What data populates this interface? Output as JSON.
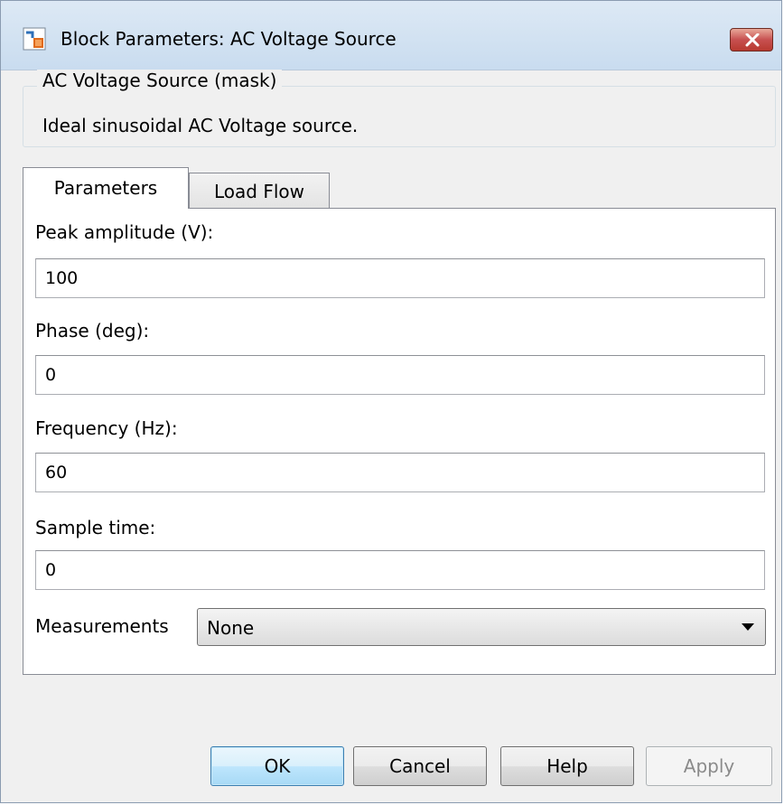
{
  "window": {
    "title": "Block Parameters: AC Voltage Source",
    "close_icon": "close-x-icon",
    "app_icon": "simulink-block-icon"
  },
  "mask": {
    "title": "AC Voltage Source (mask)",
    "description": "Ideal sinusoidal AC Voltage source."
  },
  "tabs": [
    {
      "label": "Parameters",
      "active": true
    },
    {
      "label": "Load Flow",
      "active": false
    }
  ],
  "fields": {
    "peak_amplitude": {
      "label": "Peak amplitude (V):",
      "value": "100"
    },
    "phase": {
      "label": "Phase (deg):",
      "value": "0"
    },
    "frequency": {
      "label": "Frequency (Hz):",
      "value": "60"
    },
    "sample_time": {
      "label": "Sample time:",
      "value": "0"
    }
  },
  "measurements": {
    "label": "Measurements",
    "selected": "None"
  },
  "buttons": {
    "ok": "OK",
    "cancel": "Cancel",
    "help": "Help",
    "apply": "Apply"
  },
  "colors": {
    "close_button": "#c75050",
    "default_button_border": "#3c7fb1",
    "disabled_text": "#8a8a8a"
  }
}
